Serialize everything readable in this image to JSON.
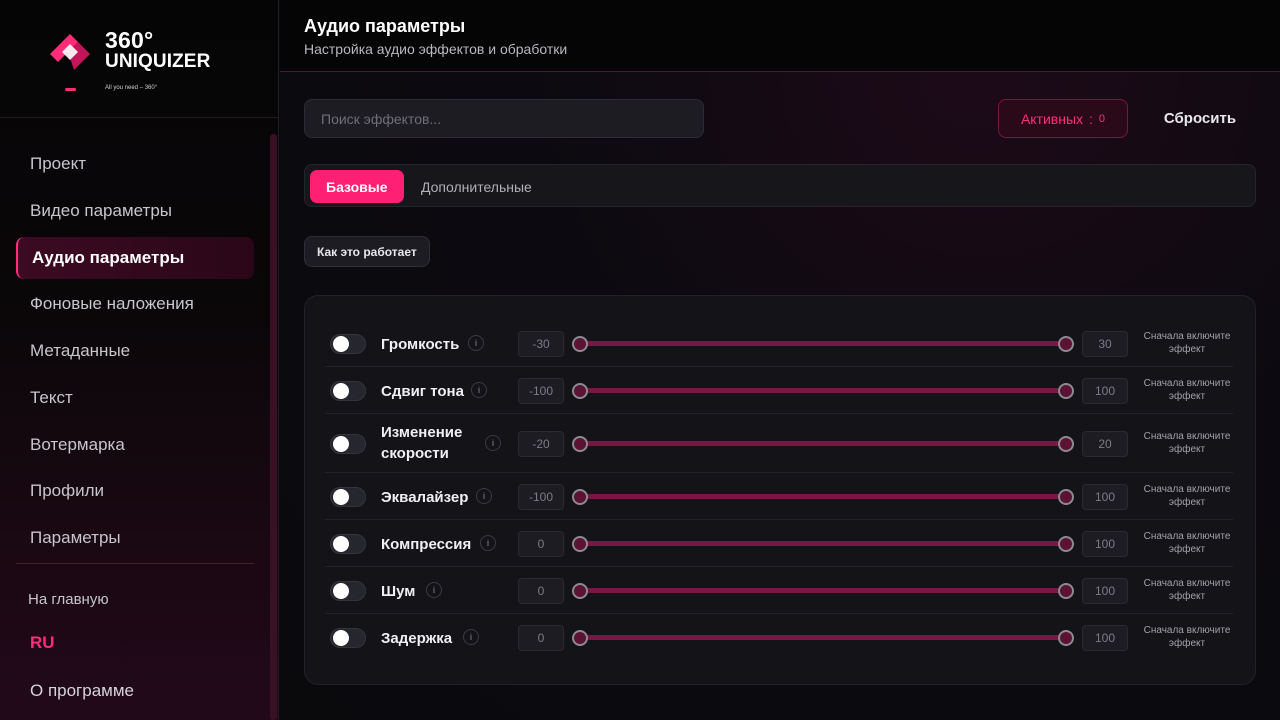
{
  "sidebar": {
    "logo": {
      "line1": "360°",
      "line2": "UNIQUIZER",
      "tagline": "All you need – 360°"
    },
    "items": [
      {
        "label": "Проект"
      },
      {
        "label": "Видео параметры"
      },
      {
        "label": "Аудио параметры",
        "active": true
      },
      {
        "label": "Фоновые наложения"
      },
      {
        "label": "Метаданные"
      },
      {
        "label": "Текст"
      },
      {
        "label": "Вотермарка"
      },
      {
        "label": "Профили"
      },
      {
        "label": "Параметры"
      }
    ],
    "home_label": "На главную",
    "language": "RU",
    "about_label": "О программе"
  },
  "header": {
    "title": "Аудио параметры",
    "subtitle": "Настройка аудио эффектов и обработки"
  },
  "toolbar": {
    "search_placeholder": "Поиск эффектов...",
    "active_label": "Активных",
    "active_sep": ":",
    "active_count": "0",
    "reset_label": "Сбросить"
  },
  "tabs": [
    {
      "label": "Базовые",
      "active": true
    },
    {
      "label": "Дополнительные",
      "active": false
    }
  ],
  "howto_label": "Как это работает",
  "effects": [
    {
      "label": "Громкость",
      "min": "-30",
      "max": "30",
      "enabled": false,
      "hint": "Сначала включите эффект"
    },
    {
      "label": "Сдвиг тона",
      "min": "-100",
      "max": "100",
      "enabled": false,
      "hint": "Сначала включите эффект"
    },
    {
      "label": "Изменение скорости",
      "min": "-20",
      "max": "20",
      "enabled": false,
      "hint": "Сначала включите эффект"
    },
    {
      "label": "Эквалайзер",
      "min": "-100",
      "max": "100",
      "enabled": false,
      "hint": "Сначала включите эффект"
    },
    {
      "label": "Компрессия",
      "min": "0",
      "max": "100",
      "enabled": false,
      "hint": "Сначала включите эффект"
    },
    {
      "label": "Шум",
      "min": "0",
      "max": "100",
      "enabled": false,
      "hint": "Сначала включите эффект"
    },
    {
      "label": "Задержка",
      "min": "0",
      "max": "100",
      "enabled": false,
      "hint": "Сначала включите эффект"
    }
  ],
  "info_glyph": "i",
  "colors": {
    "accent": "#ff1f73",
    "slider_track": "#7a1644",
    "background": "#0a0a0d"
  }
}
